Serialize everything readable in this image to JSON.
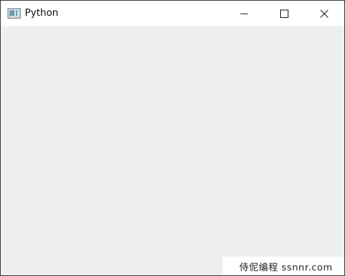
{
  "window": {
    "title": "Python",
    "app_icon": "python-window-icon",
    "controls": {
      "minimize_icon": "minimize-icon",
      "maximize_icon": "maximize-icon",
      "close_icon": "close-icon"
    }
  },
  "watermark": {
    "text": "侍伲编程 ssnnr.com"
  },
  "colors": {
    "titlebar_background": "#ffffff",
    "client_background": "#efefef",
    "window_border": "#2f2f2f",
    "text": "#111111",
    "icon_stroke": "#111111",
    "app_icon_fill": "#5b8fa3"
  }
}
